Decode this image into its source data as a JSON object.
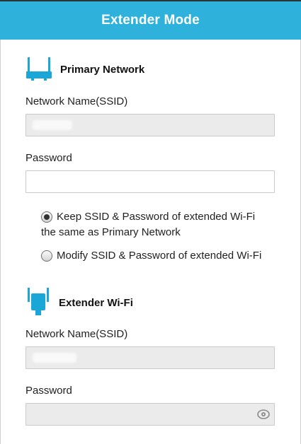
{
  "header": {
    "title": "Extender Mode"
  },
  "primary_network": {
    "title": "Primary Network",
    "icon": "router-icon",
    "ssid_label": "Network Name(SSID)",
    "ssid_value": "",
    "password_label": "Password",
    "password_value": ""
  },
  "options": {
    "keep_same_line1": "Keep SSID & Password of extended Wi-Fi",
    "keep_same_line2": "the same as Primary Network",
    "modify": "Modify SSID & Password of extended Wi-Fi",
    "selected": "keep_same"
  },
  "extender_wifi": {
    "title": "Extender Wi-Fi",
    "icon": "extender-icon",
    "ssid_label": "Network Name(SSID)",
    "ssid_value": "",
    "password_label": "Password",
    "password_value": ""
  },
  "colors": {
    "header_bg": "#2eb2db",
    "icon_blue": "#1aa6d6",
    "disabled_field": "#ebebeb"
  }
}
